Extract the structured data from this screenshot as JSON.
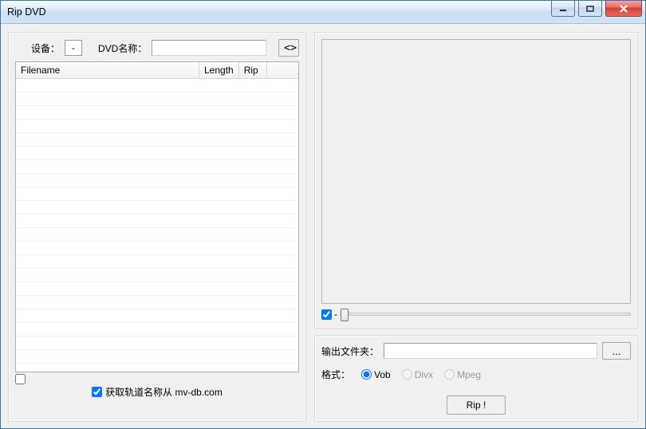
{
  "window": {
    "title": "Rip DVD"
  },
  "left": {
    "device_label": "设备：",
    "device_value": "-",
    "dvd_name_label": "DVD名称：",
    "dvd_name_value": "",
    "refresh_label": "<>",
    "columns": {
      "filename": "Filename",
      "length": "Length",
      "rip": "Rip"
    },
    "rows": [],
    "select_all_checked": false,
    "track_source_checked": true,
    "track_source_label": "获取轨道名称从 mv-db.com"
  },
  "preview": {
    "enable_checked": true,
    "position_value": "-"
  },
  "output": {
    "folder_label": "输出文件夹：",
    "folder_value": "",
    "browse_label": "...",
    "format_label": "格式：",
    "formats": {
      "vob": {
        "label": "Vob",
        "checked": true,
        "enabled": true
      },
      "divx": {
        "label": "Divx",
        "checked": false,
        "enabled": false
      },
      "mpeg": {
        "label": "Mpeg",
        "checked": false,
        "enabled": false
      }
    },
    "rip_label": "Rip !"
  }
}
